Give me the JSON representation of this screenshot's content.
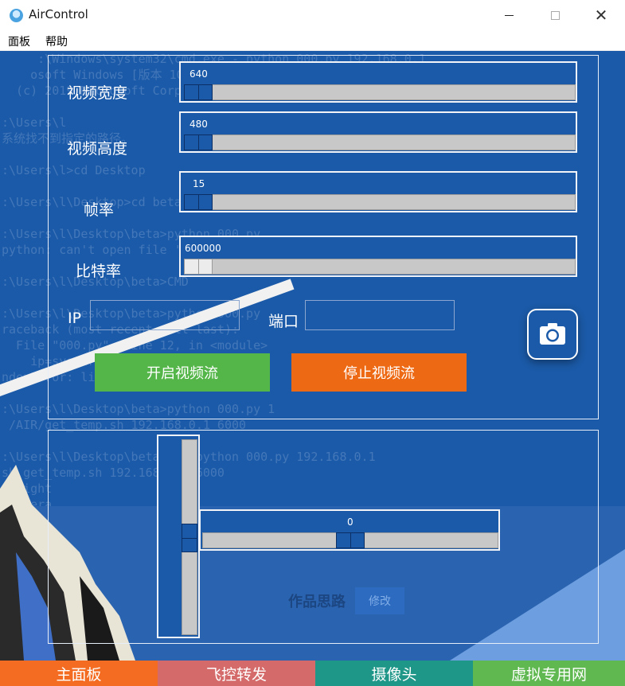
{
  "window": {
    "title": "AirControl",
    "minimize": "",
    "maximize": "",
    "close": "✕"
  },
  "menu": {
    "items": [
      "面板",
      "帮助"
    ]
  },
  "background": {
    "terminal_lines": [
      "     :\\Windows\\system32\\cmd.exe - python 000.py 192.168.0.1",
      "    osoft Windows [版本 10.0.18363.836]",
      "  (c) 2019 Microsoft Corporation. 保留所有权利。",
      "",
      ":\\Users\\l",
      "系统找不到指定的路径。",
      "",
      ":\\Users\\l>cd Desktop",
      "",
      ":\\Users\\l\\Desktop>cd beta",
      "",
      ":\\Users\\l\\Desktop\\beta>python 000.py",
      "python: can't open file '000.py': [Errno 2] No such file or directory",
      "",
      ":\\Users\\l\\Desktop\\beta>CMD",
      "",
      ":\\Users\\l\\Desktop\\beta>python 000.py",
      "raceback (most recent call last):",
      "  File \"000.py\", line 12, in <module>",
      "    ip=sys.argv[1]",
      "ndexError: list index out of range",
      "",
      ":\\Users\\l\\Desktop\\beta>python 000.py 1",
      " /AIR/get_temp.sh 192.168.0.1 6000",
      "",
      ":\\Users\\l\\Desktop\\beta\\CMD>python 000.py 192.168.0.1",
      "sh get_temp.sh 192.168.0.1 6000",
      " flight",
      " camera"
    ],
    "faint_label": "作品思路",
    "faint_button": "修改"
  },
  "controls": {
    "width": {
      "label": "视频宽度",
      "value": "640"
    },
    "height": {
      "label": "视频高度",
      "value": "480"
    },
    "fps": {
      "label": "帧率",
      "value": "15"
    },
    "bitrate": {
      "label": "比特率",
      "value": "600000"
    },
    "ip": {
      "label": "IP",
      "value": ""
    },
    "port": {
      "label": "端口",
      "value": ""
    },
    "start_button": "开启视频流",
    "stop_button": "停止视频流",
    "camera_icon": "camera-icon"
  },
  "joystick": {
    "vertical_value": "0",
    "horizontal_value": "0"
  },
  "tabs": [
    {
      "label": "主面板",
      "color": "#f36c21"
    },
    {
      "label": "飞控转发",
      "color": "#d46a6a"
    },
    {
      "label": "摄像头",
      "color": "#1e9688"
    },
    {
      "label": "虚拟专用网",
      "color": "#5fb950"
    }
  ],
  "colors": {
    "accent": "#1b5aa8",
    "start": "#54b649",
    "stop": "#ee6914"
  }
}
